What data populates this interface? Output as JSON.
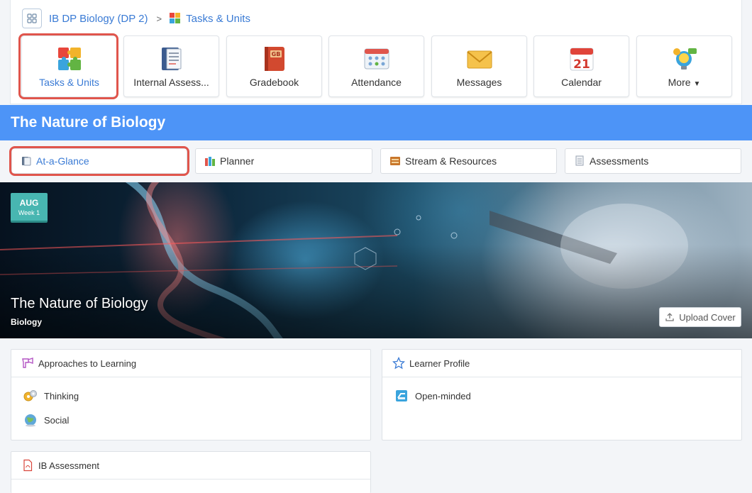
{
  "breadcrumb": {
    "course": "IB DP Biology (DP 2)",
    "separator": ">",
    "current": "Tasks & Units"
  },
  "apps": [
    {
      "label": "Tasks & Units",
      "icon": "puzzle-icon"
    },
    {
      "label": "Internal Assess...",
      "icon": "notebook-icon"
    },
    {
      "label": "Gradebook",
      "icon": "gradebook-icon"
    },
    {
      "label": "Attendance",
      "icon": "attendance-icon"
    },
    {
      "label": "Messages",
      "icon": "envelope-icon"
    },
    {
      "label": "Calendar",
      "icon": "calendar-icon",
      "calendar_day": "21"
    },
    {
      "label": "More",
      "icon": "lightbulb-icon"
    }
  ],
  "unit": {
    "title": "The Nature of Biology"
  },
  "subtabs": [
    {
      "label": "At-a-Glance",
      "icon": "book-icon"
    },
    {
      "label": "Planner",
      "icon": "books-icon"
    },
    {
      "label": "Stream & Resources",
      "icon": "stream-icon"
    },
    {
      "label": "Assessments",
      "icon": "documents-icon"
    }
  ],
  "banner": {
    "month": "AUG",
    "week": "Week 1",
    "title": "The Nature of Biology",
    "subject": "Biology",
    "upload_label": "Upload Cover"
  },
  "panels": {
    "approaches": {
      "title": "Approaches to Learning",
      "items": [
        {
          "label": "Thinking",
          "icon": "gears-icon"
        },
        {
          "label": "Social",
          "icon": "globe-icon"
        }
      ]
    },
    "learner_profile": {
      "title": "Learner Profile",
      "items": [
        {
          "label": "Open-minded",
          "icon": "open-minded-icon"
        }
      ]
    },
    "ib_assessment": {
      "title": "IB Assessment"
    }
  },
  "colors": {
    "accent": "#3a7bd5",
    "header_blue": "#4d94f7",
    "highlight_red": "#e0554c",
    "badge_teal": "#48b6b1"
  }
}
